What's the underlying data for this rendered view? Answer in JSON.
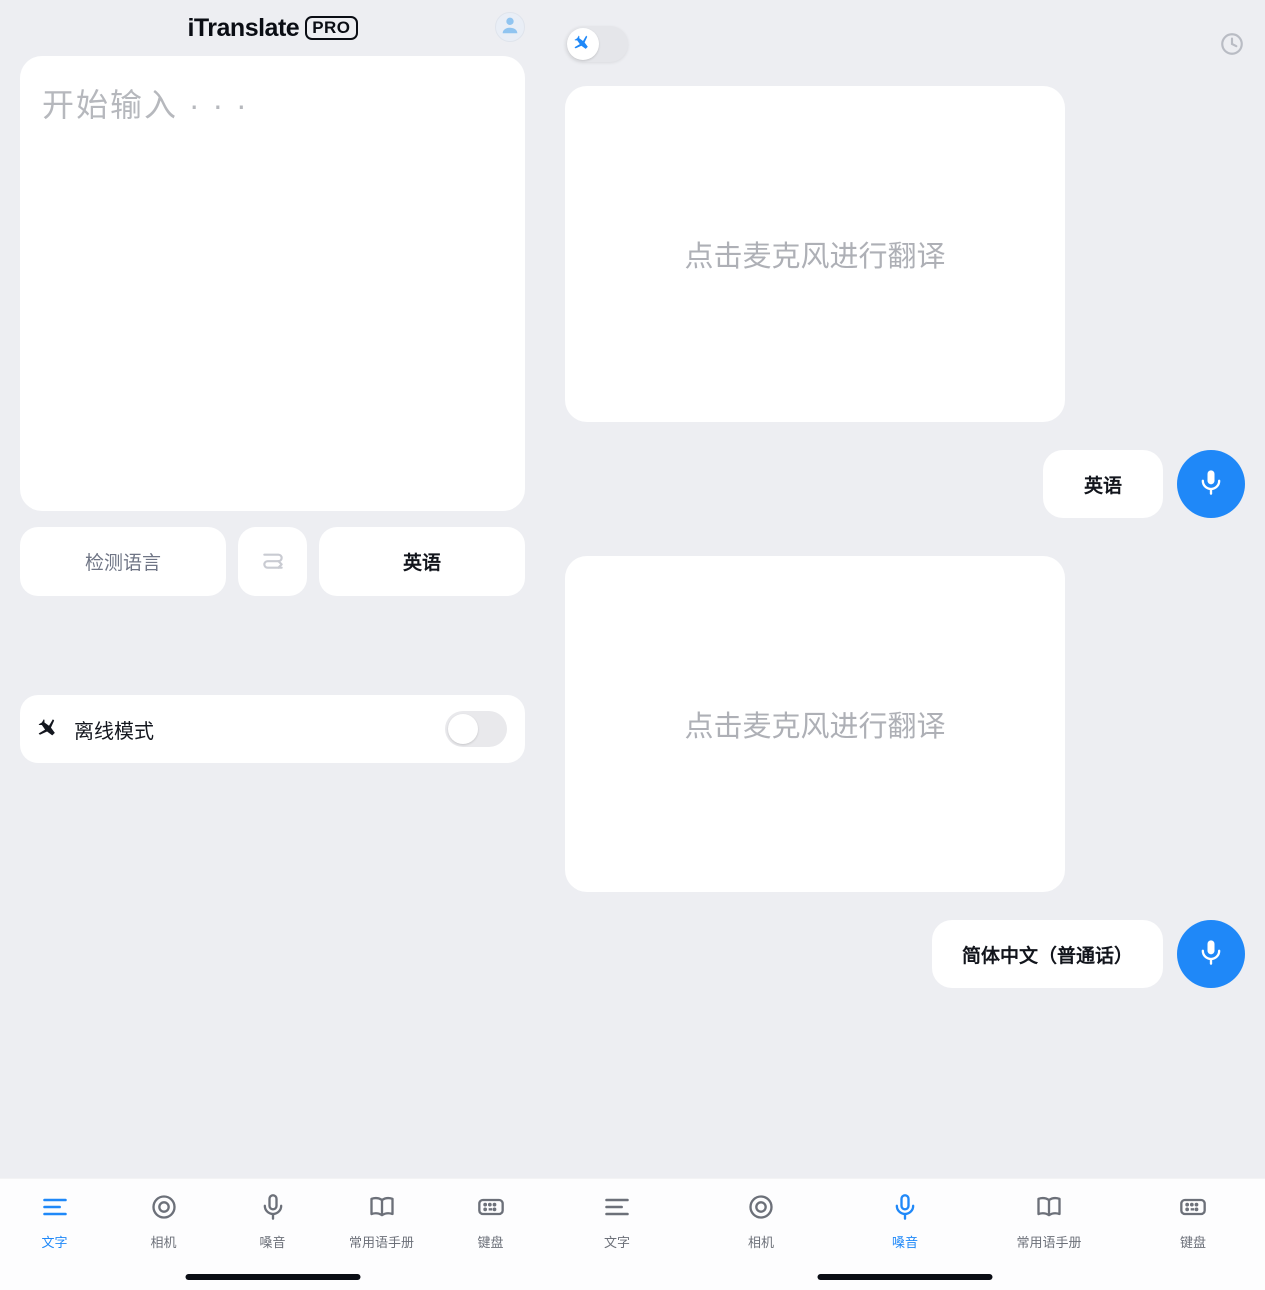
{
  "colors": {
    "accent": "#1f88f8",
    "bg": "#edeef2",
    "card": "#ffffff",
    "muted": "#aeb0b6",
    "text": "#12151c"
  },
  "icons": {
    "avatar": "avatar-icon",
    "swap": "swap-icon",
    "airplane": "airplane-icon",
    "history": "history-icon",
    "mic": "microphone-icon",
    "tab_text": "text-lines-icon",
    "tab_camera": "camera-lens-icon",
    "tab_voice": "microphone-icon",
    "tab_phrase": "book-icon",
    "tab_keyboard": "keyboard-icon"
  },
  "left": {
    "header": {
      "brand": "iTranslate",
      "badge": "PRO"
    },
    "input": {
      "placeholder": "开始输入 · · ·"
    },
    "lang": {
      "source": "检测语言",
      "target": "英语"
    },
    "offline": {
      "label": "离线模式",
      "enabled": false
    },
    "tabs": [
      {
        "key": "text",
        "label": "文字",
        "active": true
      },
      {
        "key": "camera",
        "label": "相机",
        "active": false
      },
      {
        "key": "voice",
        "label": "嗓音",
        "active": false
      },
      {
        "key": "phrase",
        "label": "常用语手册",
        "active": false
      },
      {
        "key": "keyboard",
        "label": "键盘",
        "active": false
      }
    ]
  },
  "right": {
    "toggle_on": false,
    "cards": {
      "top": {
        "prompt": "点击麦克风进行翻译",
        "language": "英语"
      },
      "bottom": {
        "prompt": "点击麦克风进行翻译",
        "language": "简体中文（普通话）"
      }
    },
    "tabs": [
      {
        "key": "text",
        "label": "文字",
        "active": false
      },
      {
        "key": "camera",
        "label": "相机",
        "active": false
      },
      {
        "key": "voice",
        "label": "嗓音",
        "active": true
      },
      {
        "key": "phrase",
        "label": "常用语手册",
        "active": false
      },
      {
        "key": "keyboard",
        "label": "键盘",
        "active": false
      }
    ]
  }
}
